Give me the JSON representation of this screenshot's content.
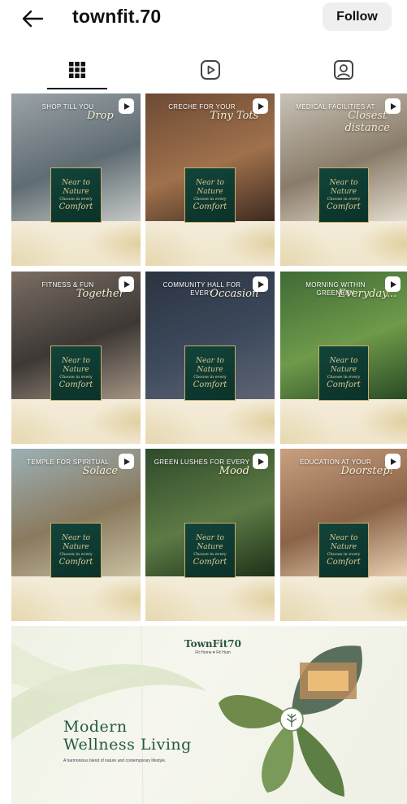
{
  "header": {
    "username": "townfit.70",
    "follow_label": "Follow"
  },
  "tabs": [
    {
      "name": "grid",
      "icon": "grid-icon",
      "active": true
    },
    {
      "name": "reels",
      "icon": "reels-icon",
      "active": false
    },
    {
      "name": "tagged",
      "icon": "tagged-icon",
      "active": false
    }
  ],
  "badge": {
    "line1": "Near to",
    "line1b": "Nature",
    "line2": "Choose in every",
    "line3": "Comfort"
  },
  "posts": [
    {
      "headline": "SHOP TILL YOU",
      "script": "Drop"
    },
    {
      "headline": "CRECHE FOR YOUR",
      "script": "Tiny Tots"
    },
    {
      "headline": "MEDICAL FACILITIES AT",
      "script": "Closest distance"
    },
    {
      "headline": "FITNESS & FUN",
      "script": "Together"
    },
    {
      "headline": "COMMUNITY HALL FOR EVERY",
      "script": "Occasion"
    },
    {
      "headline": "MORNING WITHIN GREENERY",
      "script": "Everyday..."
    },
    {
      "headline": "TEMPLE FOR SPIRITUAL",
      "script": "Solace"
    },
    {
      "headline": "GREEN LUSHES FOR EVERY",
      "script": "Mood"
    },
    {
      "headline": "EDUCATION AT YOUR",
      "script": "Doorstep!"
    }
  ],
  "big_post": {
    "logo": "TownFit70",
    "logo_tag": "Fit Home ♥ Fit Hum",
    "title_line1": "Modern",
    "title_line2": "Wellness Living",
    "subtitle": "A harmonious blend of nature and contemporary lifestyle."
  },
  "colors": {
    "badge_green": "#0f3d33",
    "badge_gold": "#c6ad6a",
    "title_green": "#245944"
  }
}
